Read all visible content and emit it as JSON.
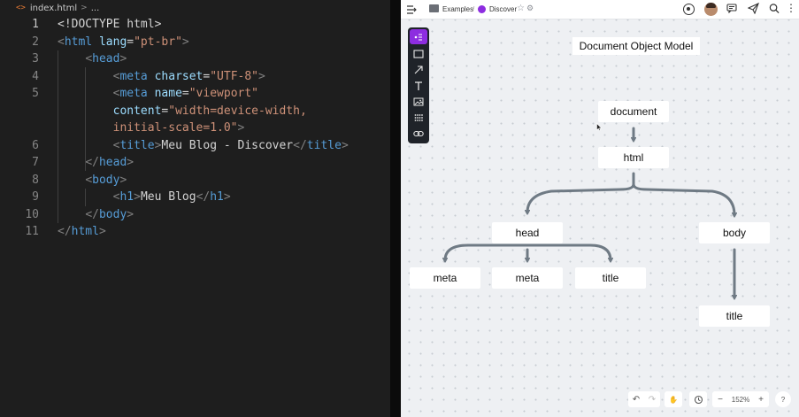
{
  "editor": {
    "file_name": "index.html",
    "breadcrumb_sep": ">",
    "breadcrumb_more": "...",
    "lines": [
      {
        "n": "1",
        "parts": [
          [
            "sel",
            "<!DOCTYPE html>"
          ]
        ]
      },
      {
        "n": "2",
        "parts": [
          [
            "br",
            "<"
          ],
          [
            "tag",
            "html"
          ],
          [
            "txt",
            " "
          ],
          [
            "at",
            "lang"
          ],
          [
            "txt",
            "="
          ],
          [
            "str",
            "\"pt-br\""
          ],
          [
            "br",
            ">"
          ]
        ]
      },
      {
        "n": "3",
        "parts": [
          [
            "txt",
            "    "
          ],
          [
            "br",
            "<"
          ],
          [
            "tag",
            "head"
          ],
          [
            "br",
            ">"
          ]
        ]
      },
      {
        "n": "4",
        "parts": [
          [
            "txt",
            "        "
          ],
          [
            "br",
            "<"
          ],
          [
            "tag",
            "meta"
          ],
          [
            "txt",
            " "
          ],
          [
            "at",
            "charset"
          ],
          [
            "txt",
            "="
          ],
          [
            "str",
            "\"UTF-8\""
          ],
          [
            "br",
            ">"
          ]
        ]
      },
      {
        "n": "5",
        "parts": [
          [
            "txt",
            "        "
          ],
          [
            "br",
            "<"
          ],
          [
            "tag",
            "meta"
          ],
          [
            "txt",
            " "
          ],
          [
            "at",
            "name"
          ],
          [
            "txt",
            "="
          ],
          [
            "str",
            "\"viewport\""
          ]
        ]
      },
      {
        "n": "",
        "parts": [
          [
            "txt",
            "        "
          ],
          [
            "at",
            "content"
          ],
          [
            "txt",
            "="
          ],
          [
            "str",
            "\"width=device-width,"
          ]
        ]
      },
      {
        "n": "",
        "parts": [
          [
            "txt",
            "        "
          ],
          [
            "str",
            "initial-scale=1.0\""
          ],
          [
            "br",
            ">"
          ]
        ]
      },
      {
        "n": "6",
        "parts": [
          [
            "txt",
            "        "
          ],
          [
            "br",
            "<"
          ],
          [
            "tag",
            "title"
          ],
          [
            "br",
            ">"
          ],
          [
            "txt",
            "Meu Blog - Discover"
          ],
          [
            "br",
            "</"
          ],
          [
            "tag",
            "title"
          ],
          [
            "br",
            ">"
          ]
        ]
      },
      {
        "n": "7",
        "parts": [
          [
            "txt",
            "    "
          ],
          [
            "br",
            "</"
          ],
          [
            "tag",
            "head"
          ],
          [
            "br",
            ">"
          ]
        ]
      },
      {
        "n": "8",
        "parts": [
          [
            "txt",
            "    "
          ],
          [
            "br",
            "<"
          ],
          [
            "tag",
            "body"
          ],
          [
            "br",
            ">"
          ]
        ]
      },
      {
        "n": "9",
        "parts": [
          [
            "txt",
            "        "
          ],
          [
            "br",
            "<"
          ],
          [
            "tag",
            "h1"
          ],
          [
            "br",
            ">"
          ],
          [
            "txt",
            "Meu Blog"
          ],
          [
            "br",
            "</"
          ],
          [
            "tag",
            "h1"
          ],
          [
            "br",
            ">"
          ]
        ]
      },
      {
        "n": "10",
        "parts": [
          [
            "txt",
            "    "
          ],
          [
            "br",
            "</"
          ],
          [
            "tag",
            "body"
          ],
          [
            "br",
            ">"
          ]
        ]
      },
      {
        "n": "11",
        "parts": [
          [
            "br",
            "</"
          ],
          [
            "tag",
            "html"
          ],
          [
            "br",
            ">"
          ]
        ]
      }
    ]
  },
  "board": {
    "breadcrumb": {
      "folder": "Examples",
      "board": "Discover"
    },
    "title": "Document Object Model",
    "nodes": {
      "document": "document",
      "html": "html",
      "head": "head",
      "body": "body",
      "meta1": "meta",
      "meta2": "meta",
      "title_head": "title",
      "title_body": "title"
    },
    "zoom": "152%",
    "help": "?",
    "accent_color": "#8d2de0",
    "arrow_color": "#6f7a84"
  }
}
